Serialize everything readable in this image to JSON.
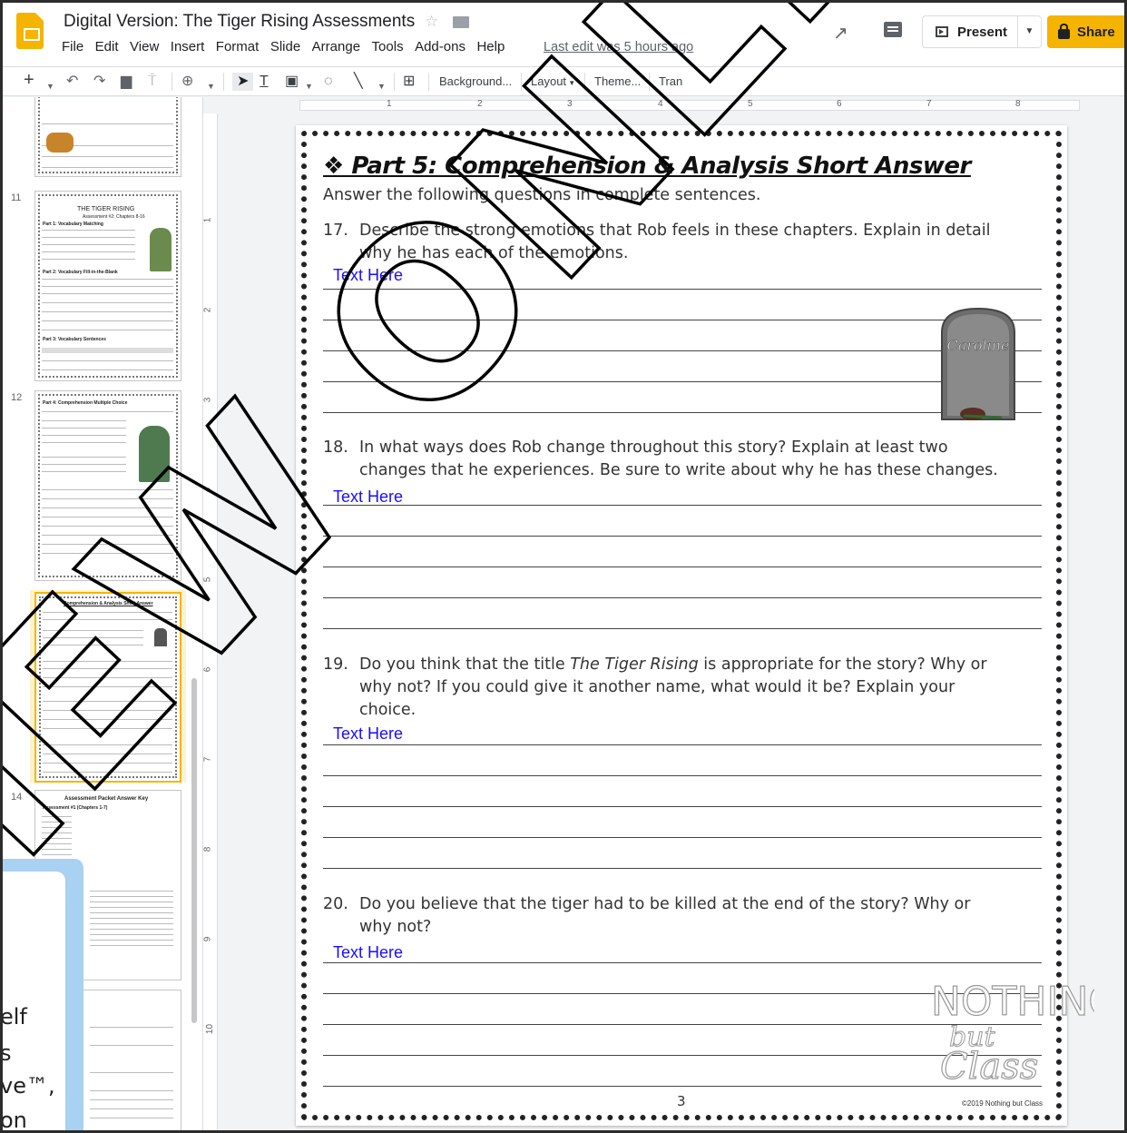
{
  "app": {
    "title": "Digital Version: The Tiger Rising Assessments",
    "last_edit": "Last edit was 5 hours ago",
    "menu": [
      "File",
      "Edit",
      "View",
      "Insert",
      "Format",
      "Slide",
      "Arrange",
      "Tools",
      "Add-ons",
      "Help"
    ],
    "present_label": "Present",
    "share_label": "Share",
    "accent_color": "#f4b400"
  },
  "toolbar": {
    "background_label": "Background...",
    "layout_label": "Layout",
    "theme_label": "Theme...",
    "transition_label": "Tran"
  },
  "ruler": {
    "horizontal": [
      "1",
      "2",
      "3",
      "4",
      "5",
      "6",
      "7",
      "8"
    ],
    "vertical": [
      "1",
      "2",
      "3",
      "4",
      "5",
      "6",
      "7",
      "8",
      "9",
      "10"
    ]
  },
  "filmstrip": {
    "slide_numbers": [
      "11",
      "12",
      "14"
    ],
    "thumb_11_title": "THE TIGER RISING",
    "thumb_11_subtitle": "Assessment #2: Chapters 8-16",
    "thumb_11_part1": "Part 1: Vocabulary Matching",
    "thumb_11_part2": "Part 2: Vocabulary Fill-in-the-Blank",
    "thumb_11_part3": "Part 3: Vocabulary Sentences",
    "thumb_12_part4": "Part 4: Comprehension Multiple Choice",
    "thumb_13_part5": "Comprehension & Analysis Short Answer",
    "thumb_14_title": "Assessment Packet Answer Key",
    "thumb_14_sub": "Assessment #1 (Chapters 1-7)"
  },
  "slide": {
    "heading": "❖ Part 5: Comprehension & Analysis Short Answer",
    "instructions": "Answer the following questions in complete sentences.",
    "questions": [
      {
        "num": "17.",
        "line1": "Describe the strong emotions that Rob feels in these chapters. Explain in detail",
        "line2": "why he has each of the emotions.",
        "answer": "Text Here"
      },
      {
        "num": "18.",
        "line1": "In what ways does Rob change throughout this story? Explain at least two",
        "line2": "changes that he experiences. Be sure to write about why he has these changes.",
        "answer": "Text Here"
      },
      {
        "num": "19.",
        "line1_a": "Do you think that the title ",
        "line1_title": "The Tiger Rising",
        "line1_b": " is appropriate for the story? Why or",
        "line2": "why not? If you could give it another name, what would it be? Explain your",
        "line3": "choice.",
        "answer": "Text Here"
      },
      {
        "num": "20.",
        "line1": "Do you believe that the tiger had to be killed at the end of the story? Why or",
        "line2": "why not?",
        "answer": "Text Here"
      }
    ],
    "tombstone_name": "Caroline",
    "page_number": "3",
    "copyright": "©2019 Nothing but Class",
    "brand_word1": "NOTHING",
    "brand_word2": "but",
    "brand_word3": "Class"
  },
  "watermark": "VIEW ONLY",
  "promo": {
    "lines": [
      "elf",
      "s",
      "ve™,",
      "on"
    ]
  }
}
